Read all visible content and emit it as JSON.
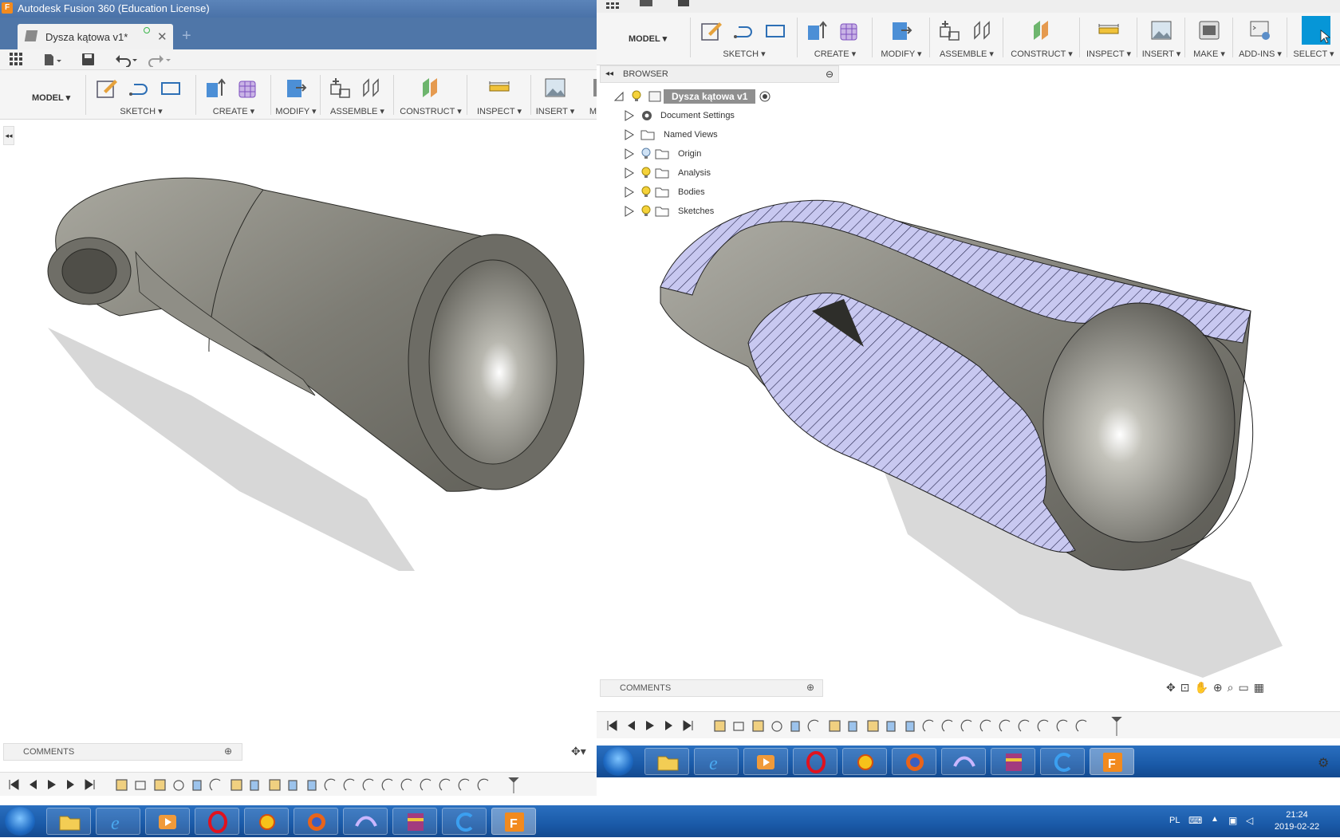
{
  "left_window": {
    "title": "Autodesk Fusion 360 (Education License)",
    "doc_tab": "Dysza kątowa v1*",
    "mode": "MODEL",
    "ribbon_groups": [
      "SKETCH",
      "CREATE",
      "MODIFY",
      "ASSEMBLE",
      "CONSTRUCT",
      "INSPECT",
      "INSERT",
      "M"
    ],
    "comments": "COMMENTS"
  },
  "right_window": {
    "mode": "MODEL",
    "ribbon_groups": [
      "SKETCH",
      "CREATE",
      "MODIFY",
      "ASSEMBLE",
      "CONSTRUCT",
      "INSPECT",
      "INSERT",
      "MAKE",
      "ADD-INS",
      "SELECT"
    ],
    "browser": {
      "title": "BROWSER",
      "root": "Dysza kątowa v1",
      "items": [
        "Document Settings",
        "Named Views",
        "Origin",
        "Analysis",
        "Bodies",
        "Sketches"
      ]
    },
    "comments": "COMMENTS"
  },
  "taskbar": {
    "lang": "PL",
    "time": "21:24",
    "date": "2019-02-22"
  },
  "colors": {
    "accent": "#0696d7",
    "section_fill": "#c8c8f0",
    "body_metal": "#8a8a82"
  }
}
